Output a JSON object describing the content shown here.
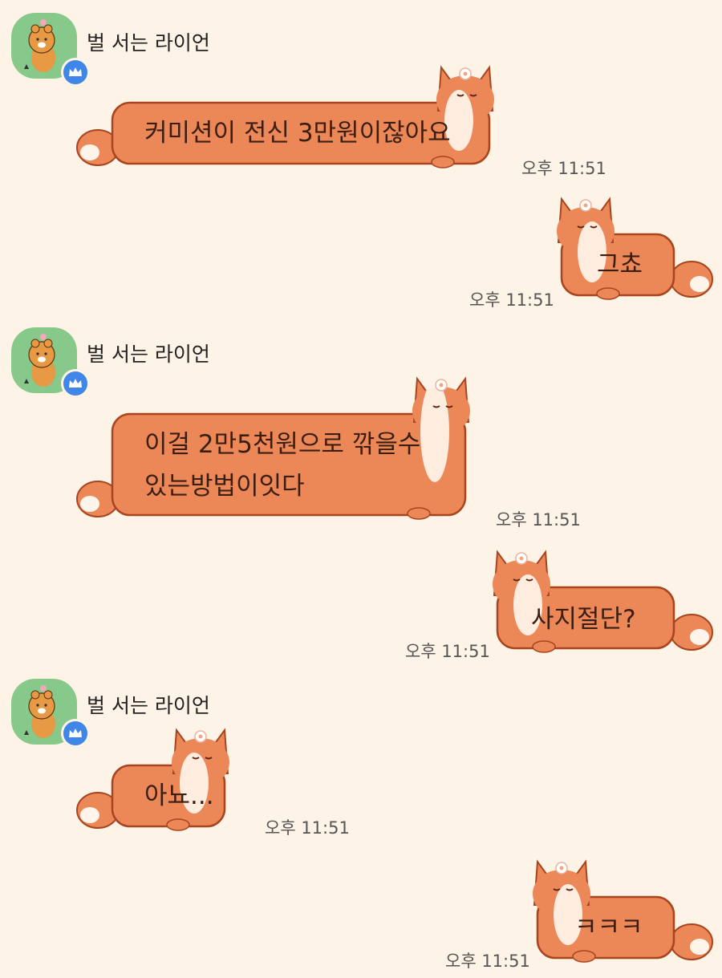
{
  "colors": {
    "background": "#FDF3E6",
    "bubble_fill": "#EC8757",
    "bubble_outline": "#A8451F",
    "avatar_bg": "#86C98A",
    "badge": "#3F86E8"
  },
  "icons": {
    "avatar": "ryan-lion-avatar-icon",
    "badge": "crown-badge-icon",
    "bubble": "fox-bubble"
  },
  "messages": [
    {
      "sender": "벌 서는 라이언",
      "side": "left",
      "lines": [
        "커미션이 전신 3만원이잖아요"
      ],
      "time": "오후 11:51"
    },
    {
      "side": "right",
      "lines": [
        "그쵸"
      ],
      "time": "오후 11:51"
    },
    {
      "sender": "벌 서는 라이언",
      "side": "left",
      "lines": [
        "이걸 2만5천원으로 깎을수",
        "있는방법이잇다"
      ],
      "time": "오후 11:51"
    },
    {
      "side": "right",
      "lines": [
        "사지절단?"
      ],
      "time": "오후 11:51"
    },
    {
      "sender": "벌 서는 라이언",
      "side": "left",
      "lines": [
        "아뇨..."
      ],
      "time": "오후 11:51"
    },
    {
      "side": "right",
      "lines": [
        "ㅋㅋㅋ"
      ],
      "time": "오후 11:51"
    }
  ]
}
